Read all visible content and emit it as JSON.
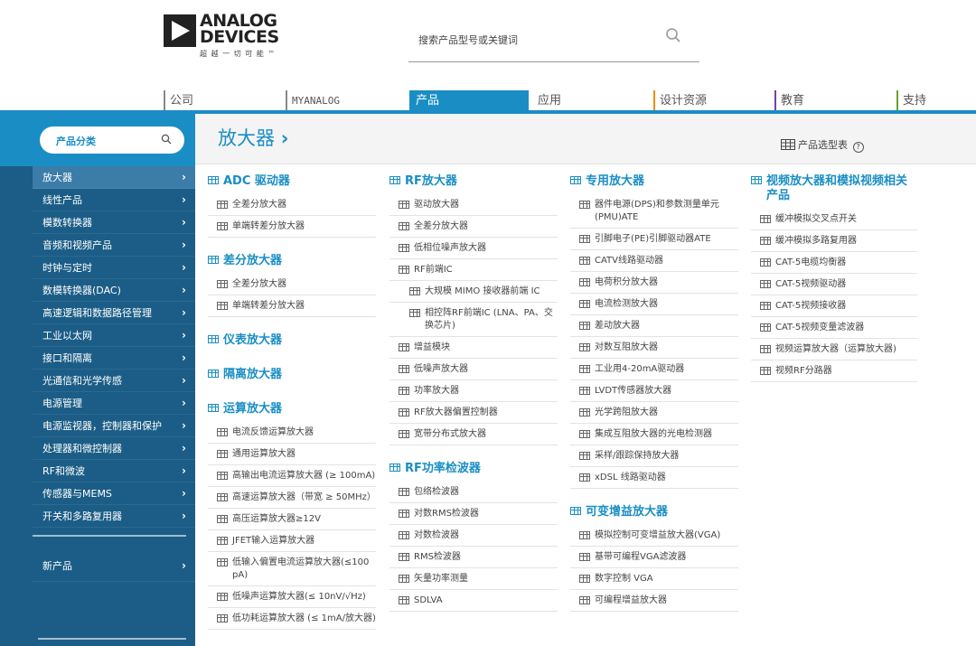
{
  "logo": {
    "line1": "ANALOG",
    "line2": "DEVICES",
    "tagline": "超 越 一 切 可 能 ™"
  },
  "search": {
    "placeholder": "搜索产品型号或关键词"
  },
  "nav": {
    "company": "公司",
    "myanalog": "MYANALOG",
    "products": "产品",
    "applications": "应用",
    "design": "设计资源",
    "education": "教育",
    "support": "支持"
  },
  "sidebar": {
    "category_label": "产品分类",
    "items": [
      "放大器",
      "线性产品",
      "模数转换器",
      "音频和视频产品",
      "时钟与定时",
      "数模转换器(DAC)",
      "高速逻辑和数据路径管理",
      "工业以太网",
      "接口和隔离",
      "光通信和光学传感",
      "电源管理",
      "电源监视器，控制器和保护",
      "处理器和微控制器",
      "RF和微波",
      "传感器与MEMS",
      "开关和多路复用器"
    ],
    "new_products": "新产品"
  },
  "title": {
    "page": "放大器",
    "arrow": "›",
    "selector": "产品选型表",
    "help": "?"
  },
  "columns": {
    "c1": {
      "s1": {
        "head": "ADC 驱动器",
        "items": [
          "全差分放大器",
          "单端转差分放大器"
        ]
      },
      "s2": {
        "head": "差分放大器",
        "items": [
          "全差分放大器",
          "单端转差分放大器"
        ]
      },
      "s3": {
        "head": "仪表放大器"
      },
      "s4": {
        "head": "隔离放大器"
      },
      "s5": {
        "head": "运算放大器",
        "items": [
          "电流反馈运算放大器",
          "通用运算放大器",
          "高输出电流运算放大器 (≥ 100mA)",
          "高速运算放大器（带宽 ≥ 50MHz）",
          "高压运算放大器≥12V",
          "JFET输入运算放大器",
          "低输入偏置电流运算放大器(≤100 pA)",
          "低噪声运算放大器(≤ 10nV/√Hz)",
          "低功耗运算放大器 (≤ 1mA/放大器)"
        ]
      }
    },
    "c2": {
      "s1": {
        "head": "RF放大器",
        "items": [
          "驱动放大器",
          "全差分放大器",
          "低相位噪声放大器",
          "RF前端IC"
        ],
        "deep": [
          "大规模 MIMO 接收器前端 IC",
          "相控阵RF前端IC (LNA、PA、交换芯片)"
        ],
        "items2": [
          "增益模块",
          "低噪声放大器",
          "功率放大器",
          "RF放大器偏置控制器",
          "宽带分布式放大器"
        ]
      },
      "s2": {
        "head": "RF功率检波器",
        "items": [
          "包络检波器",
          "对数RMS检波器",
          "对数检波器",
          "RMS检波器",
          "矢量功率测量",
          "SDLVA"
        ]
      }
    },
    "c3": {
      "s1": {
        "head": "专用放大器",
        "items": [
          "器件电源(DPS)和参数测量单元(PMU)ATE",
          "引脚电子(PE)引脚驱动器ATE",
          "CATV线路驱动器",
          "电荷积分放大器",
          "电流检测放大器",
          "差动放大器",
          "对数互阻放大器",
          "工业用4-20mA驱动器",
          "LVDT传感器放大器",
          "光学跨阻放大器",
          "集成互阻放大器的光电检测器",
          "采样/跟踪保持放大器",
          "xDSL 线路驱动器"
        ]
      },
      "s2": {
        "head": "可变增益放大器",
        "items": [
          "模拟控制可变增益放大器(VGA)",
          "基带可编程VGA滤波器",
          "数字控制 VGA",
          "可编程增益放大器"
        ]
      }
    },
    "c4": {
      "s1": {
        "head": "视频放大器和模拟视频相关产品",
        "items": [
          "缓冲模拟交叉点开关",
          "缓冲模拟多路复用器",
          "CAT-5电缆均衡器",
          "CAT-5视频驱动器",
          "CAT-5视频接收器",
          "CAT-5视频变量滤波器",
          "视频运算放大器（运算放大器)",
          "视频RF分路器"
        ]
      }
    }
  }
}
